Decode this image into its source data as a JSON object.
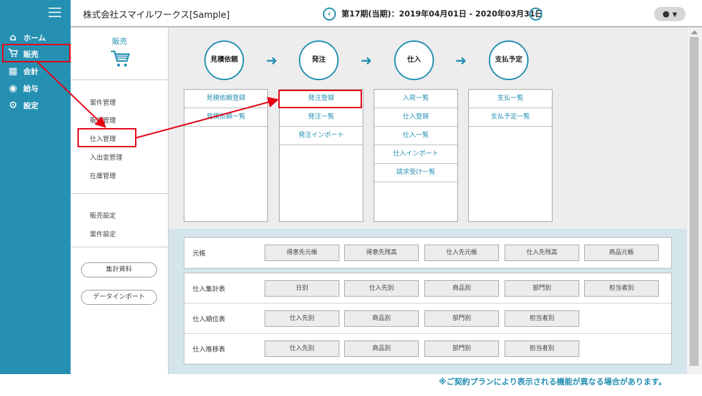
{
  "app": {
    "company": "株式会社スマイルワークス[Sample]",
    "period": "第17期(当期)：2019年04月01日 - 2020年03月31日",
    "user_icon": "user-icon"
  },
  "nav": {
    "items": [
      {
        "label": "ホーム",
        "icon": "home-icon"
      },
      {
        "label": "販売",
        "icon": "cart-icon"
      },
      {
        "label": "会計",
        "icon": "calculator-icon"
      },
      {
        "label": "給与",
        "icon": "moneybag-icon"
      },
      {
        "label": "設定",
        "icon": "gear-icon"
      }
    ]
  },
  "submenu": {
    "title": "販売",
    "group1": [
      "案件管理",
      "販売管理",
      "仕入管理",
      "入出金管理",
      "在庫管理"
    ],
    "group2": [
      "販売設定",
      "案件設定"
    ],
    "buttons": [
      "集計資料",
      "データインポート"
    ]
  },
  "flow": {
    "steps": [
      "見積依頼",
      "発注",
      "仕入",
      "支払予定"
    ],
    "columns": [
      [
        "見積依頼登録",
        "見積依頼一覧"
      ],
      [
        "発注登録",
        "発注一覧",
        "発注インポート"
      ],
      [
        "入荷一覧",
        "仕入登録",
        "仕入一覧",
        "仕入インポート",
        "請求受け一覧"
      ],
      [
        "支払一覧",
        "支払予定一覧"
      ]
    ]
  },
  "reports": {
    "ledger": {
      "label": "元帳",
      "buttons": [
        "得意先元帳",
        "得意先残高",
        "仕入先元帳",
        "仕入先残高",
        "商品元帳"
      ]
    },
    "rows": [
      {
        "label": "仕入集計表",
        "buttons": [
          "日別",
          "仕入先別",
          "商品別",
          "部門別",
          "担当者別"
        ]
      },
      {
        "label": "仕入順位表",
        "buttons": [
          "仕入先別",
          "商品別",
          "部門別",
          "担当者別"
        ]
      },
      {
        "label": "仕入推移表",
        "buttons": [
          "仕入先別",
          "商品別",
          "部門別",
          "担当者別"
        ]
      }
    ]
  },
  "note": "※ご契約プランにより表示される機能が異なる場合があります。",
  "colors": {
    "accent": "#2590b2",
    "highlight": "#e60012",
    "report_bg": "#d4e5ec"
  }
}
